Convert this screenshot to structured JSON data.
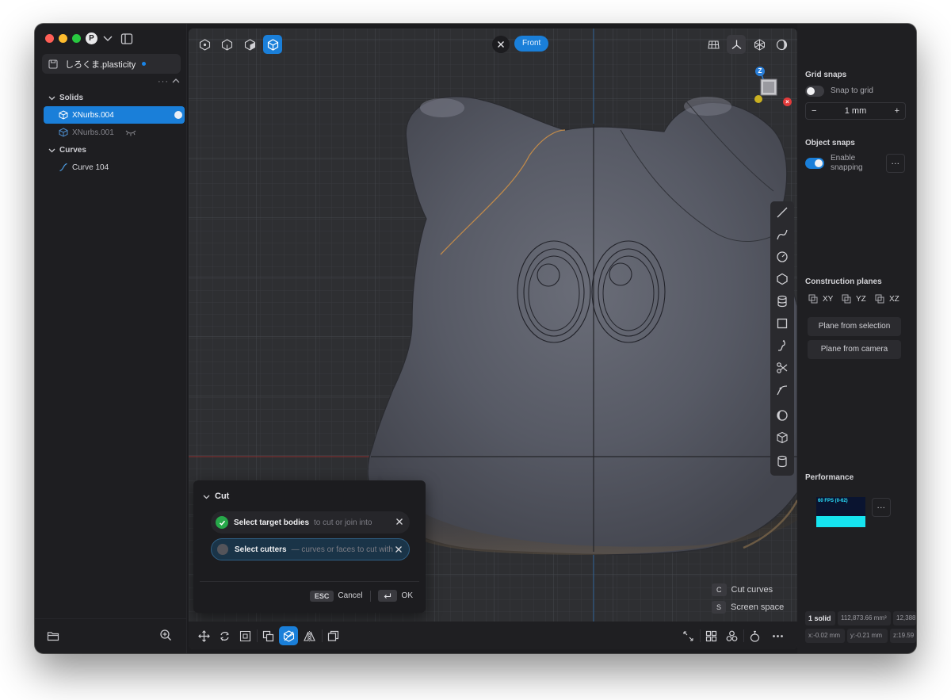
{
  "sidebar": {
    "profile_initial": "P",
    "file_name": "しろくま.plasticity",
    "tree": {
      "solids_label": "Solids",
      "items": [
        {
          "label": "XNurbs.004"
        },
        {
          "label": "XNurbs.001"
        }
      ],
      "curves_label": "Curves",
      "curve_items": [
        {
          "label": "Curve 104"
        }
      ]
    }
  },
  "viewport": {
    "view_name": "Front",
    "gizmo_axis_label": "Z",
    "hints": [
      {
        "key": "C",
        "label": "Cut curves"
      },
      {
        "key": "S",
        "label": "Screen space"
      }
    ]
  },
  "cut_dialog": {
    "title": "Cut",
    "step1": {
      "label": "Select target bodies",
      "sub": "to cut or join into"
    },
    "step2": {
      "label": "Select cutters",
      "sub": "— curves or faces to cut with"
    },
    "cancel_key": "ESC",
    "cancel_label": "Cancel",
    "ok_label": "OK"
  },
  "right_panel": {
    "grid_snaps_title": "Grid snaps",
    "snap_to_grid_label": "Snap to grid",
    "grid_value": "1 mm",
    "object_snaps_title": "Object snaps",
    "enable_snapping_line1": "Enable",
    "enable_snapping_line2": "snapping",
    "more_label": "...",
    "construction_planes_title": "Construction planes",
    "planes": [
      "XY",
      "YZ",
      "XZ"
    ],
    "plane_from_selection": "Plane from selection",
    "plane_from_camera": "Plane from camera",
    "performance_title": "Performance",
    "fps_label": "60 FPS (0-62)",
    "stats": {
      "solid_count": "1 solid",
      "volume": "112,873.66 mm³",
      "extra": "12,388",
      "x": "x:-0.02 mm",
      "y": "y:-0.21 mm",
      "z": "z:19.59"
    }
  },
  "colors": {
    "accent": "#1a7fd9",
    "window_bg": "#1c1c1f",
    "viewport_bg": "#2e2f32",
    "model": "#575a65",
    "success": "#27a84a"
  }
}
